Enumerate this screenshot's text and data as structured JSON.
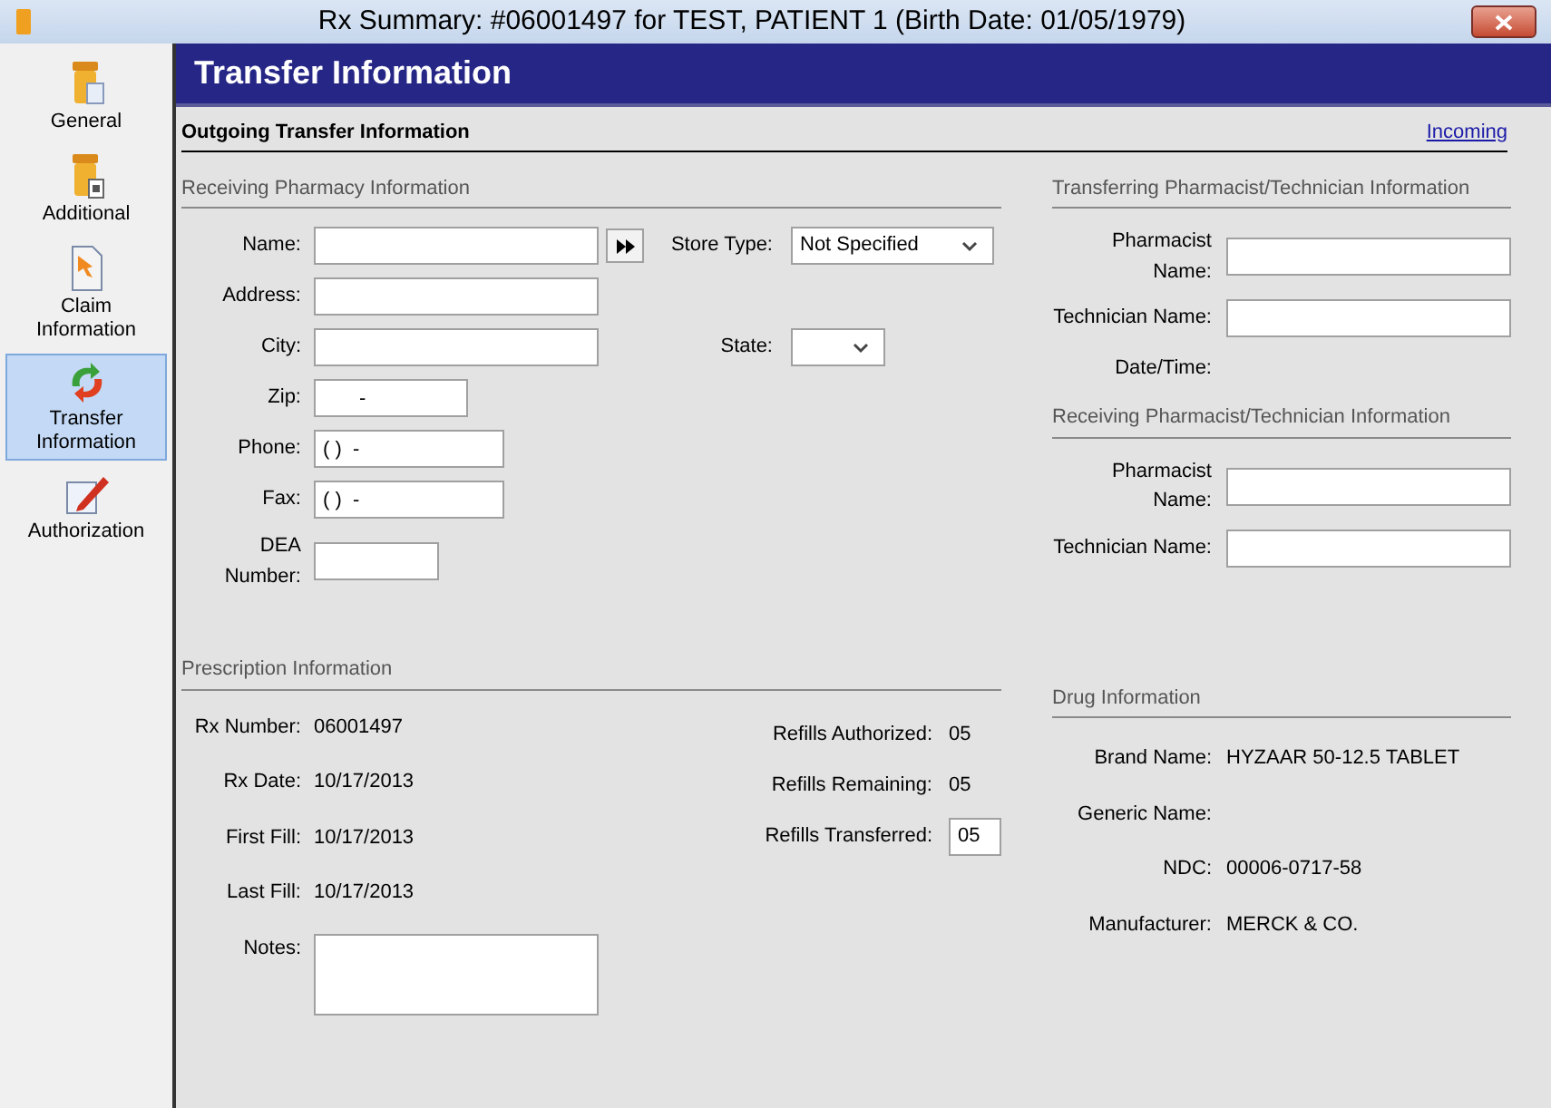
{
  "window": {
    "title": "Rx Summary: #06001497 for TEST, PATIENT 1 (Birth Date: 01/05/1979)"
  },
  "sidebar": {
    "items": [
      {
        "label": "General",
        "selected": false
      },
      {
        "label": "Additional",
        "selected": false
      },
      {
        "label": "Claim Information",
        "selected": false
      },
      {
        "label": "Transfer Information",
        "selected": true
      },
      {
        "label": "Authorization",
        "selected": false
      }
    ]
  },
  "header": {
    "title": "Transfer Information"
  },
  "outgoing": {
    "title": "Outgoing Transfer Information",
    "link": "Incoming"
  },
  "receiving_pharmacy": {
    "heading": "Receiving Pharmacy Information",
    "name": {
      "label": "Name:"
    },
    "store_type": {
      "label": "Store Type:",
      "value": "Not Specified"
    },
    "address": {
      "label": "Address:"
    },
    "city": {
      "label": "City:"
    },
    "state": {
      "label": "State:"
    },
    "zip": {
      "label": "Zip:",
      "value": "-"
    },
    "phone": {
      "label": "Phone:",
      "value": "( )  -"
    },
    "fax": {
      "label": "Fax:",
      "value": "( )  -"
    },
    "dea": {
      "label": "DEA Number:"
    }
  },
  "transferring": {
    "heading": "Transferring Pharmacist/Technician Information",
    "fields": [
      {
        "label": "Pharmacist Name:"
      },
      {
        "label": "Technician Name:"
      }
    ],
    "date_time": {
      "label": "Date/Time:"
    }
  },
  "receiving_pharmacist": {
    "heading": "Receiving Pharmacist/Technician Information",
    "fields": [
      {
        "label": "Pharmacist Name:"
      },
      {
        "label": "Technician Name:"
      }
    ]
  },
  "prescription": {
    "heading": "Prescription Information",
    "rows": [
      {
        "label": "Rx Number:",
        "value": "06001497"
      },
      {
        "label": "Rx Date:",
        "value": "10/17/2013"
      },
      {
        "label": "First Fill:",
        "value": "10/17/2013"
      },
      {
        "label": "Last Fill:",
        "value": "10/17/2013"
      }
    ],
    "refills": [
      {
        "label": "Refills Authorized:",
        "value": "05",
        "kind": "text"
      },
      {
        "label": "Refills Remaining:",
        "value": "05",
        "kind": "text"
      },
      {
        "label": "Refills Transferred:",
        "value": "05",
        "kind": "input"
      }
    ],
    "notes": {
      "label": "Notes:"
    }
  },
  "drug": {
    "heading": "Drug Information",
    "rows": [
      {
        "label": "Brand Name:",
        "value": "HYZAAR 50-12.5 TABLET"
      },
      {
        "label": "Generic Name:"
      },
      {
        "label": "NDC:",
        "value": "00006-0717-58"
      },
      {
        "label": "Manufacturer:",
        "value": "MERCK & CO."
      }
    ]
  }
}
